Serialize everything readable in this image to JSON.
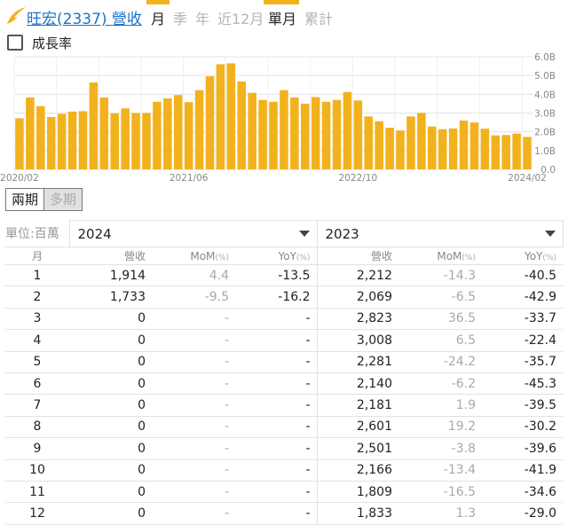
{
  "header": {
    "stock_label": "旺宏(2337) 營收",
    "tabs": [
      {
        "label": "月",
        "active": true
      },
      {
        "label": "季",
        "active": false
      },
      {
        "label": "年",
        "active": false
      },
      {
        "label": "近12月",
        "active": false
      },
      {
        "label": "單月",
        "active": true
      },
      {
        "label": "累計",
        "active": false
      }
    ],
    "growth_label": "成長率",
    "accent_color": "#f2b21e"
  },
  "chart_data": {
    "type": "bar",
    "x_ticks": [
      "2020/02",
      "2021/06",
      "2022/10",
      "2024/02"
    ],
    "y_ticks": [
      "6.0B",
      "5.0B",
      "4.0B",
      "3.0B",
      "2.0B",
      "1.0B",
      "0.0"
    ],
    "ylim": [
      0,
      6
    ],
    "grid": true,
    "color": "#f2b21e",
    "start_month": "2020/02",
    "values": [
      2.72,
      3.83,
      3.37,
      2.79,
      2.96,
      3.08,
      3.1,
      4.63,
      3.83,
      2.98,
      3.25,
      3.0,
      3.0,
      3.6,
      3.78,
      3.96,
      3.58,
      4.22,
      4.96,
      5.6,
      5.65,
      4.68,
      4.08,
      3.7,
      3.6,
      4.22,
      3.83,
      3.5,
      3.85,
      3.6,
      3.7,
      4.12,
      3.67,
      2.82,
      2.56,
      2.22,
      2.07,
      2.82,
      3.01,
      2.28,
      2.14,
      2.18,
      2.6,
      2.5,
      2.17,
      1.81,
      1.83,
      1.91,
      1.73
    ]
  },
  "period_toggle": {
    "on": "兩期",
    "off": "多期"
  },
  "table": {
    "unit": "單位:百萬",
    "year_a": "2024",
    "year_b": "2023",
    "col_month": "月",
    "col_rev": "營收",
    "col_mom": "MoM",
    "col_yoy": "YoY",
    "pct": "(%)",
    "rows": [
      [
        "1",
        "1,914",
        "4.4",
        "-13.5",
        "2,212",
        "-14.3",
        "-40.5"
      ],
      [
        "2",
        "1,733",
        "-9.5",
        "-16.2",
        "2,069",
        "-6.5",
        "-42.9"
      ],
      [
        "3",
        "0",
        "-",
        "-",
        "2,823",
        "36.5",
        "-33.7"
      ],
      [
        "4",
        "0",
        "-",
        "-",
        "3,008",
        "6.5",
        "-22.4"
      ],
      [
        "5",
        "0",
        "-",
        "-",
        "2,281",
        "-24.2",
        "-35.7"
      ],
      [
        "6",
        "0",
        "-",
        "-",
        "2,140",
        "-6.2",
        "-45.3"
      ],
      [
        "7",
        "0",
        "-",
        "-",
        "2,181",
        "1.9",
        "-39.5"
      ],
      [
        "8",
        "0",
        "-",
        "-",
        "2,601",
        "19.2",
        "-30.2"
      ],
      [
        "9",
        "0",
        "-",
        "-",
        "2,501",
        "-3.8",
        "-39.6"
      ],
      [
        "10",
        "0",
        "-",
        "-",
        "2,166",
        "-13.4",
        "-41.9"
      ],
      [
        "11",
        "0",
        "-",
        "-",
        "1,809",
        "-16.5",
        "-34.6"
      ],
      [
        "12",
        "0",
        "-",
        "-",
        "1,833",
        "1.3",
        "-29.0"
      ]
    ]
  }
}
